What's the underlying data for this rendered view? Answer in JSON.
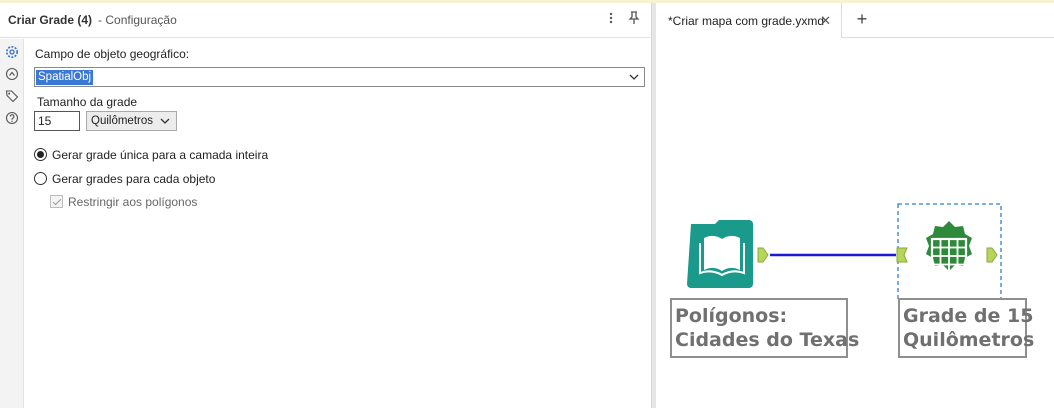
{
  "config": {
    "title": "Criar Grade (4)",
    "subtitle": "- Configuração",
    "field_label": "Campo de objeto geográfico:",
    "field_value": "SpatialObj",
    "grid_size_label": "Tamanho da grade",
    "grid_size_value": "15",
    "unit_value": "Quilômetros",
    "radio_single_label": "Gerar grade única para a camada inteira",
    "radio_single_selected": true,
    "radio_each_label": "Gerar grades para cada objeto",
    "radio_each_selected": false,
    "checkbox_label": "Restringir aos polígonos",
    "checkbox_checked": true,
    "checkbox_disabled": true
  },
  "header_icons": [
    "kebab-menu-icon",
    "pin-icon"
  ],
  "sidebar_icons": [
    "gear-icon",
    "arrows-icon",
    "tag-icon",
    "help-icon"
  ],
  "workflow": {
    "tab_label": "*Criar mapa com grade.yxmd",
    "nodes": [
      {
        "label_line1": "Polígonos:",
        "label_line2": "Cidades do Texas",
        "icon": "book-folder-icon",
        "color": "#1a9a8a"
      },
      {
        "label_line1": "Grade de 15",
        "label_line2": "Quilômetros",
        "icon": "grid-badge-icon",
        "color": "#2e8a3a",
        "selected": true
      }
    ],
    "connection_color": "#1a1acc",
    "anchor_color": "#b5d65a"
  }
}
